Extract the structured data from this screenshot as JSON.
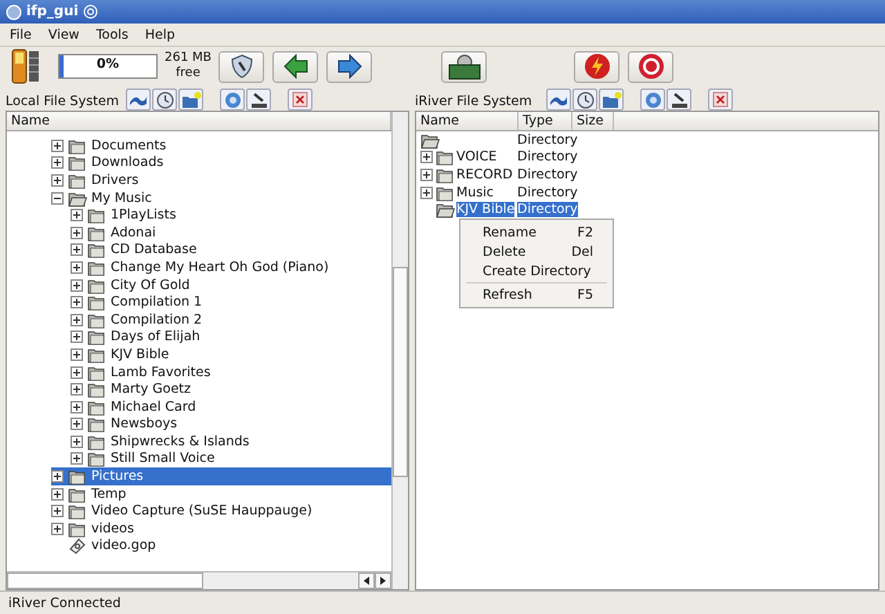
{
  "window": {
    "title": "ifp_gui"
  },
  "menu": [
    "File",
    "View",
    "Tools",
    "Help"
  ],
  "toolbar": {
    "progress": {
      "level": 0,
      "reading": "0%"
    },
    "free_space": "261 MB free"
  },
  "local": {
    "title": "Local File System",
    "column": "Name",
    "tree": [
      {
        "name": "Documents",
        "kind": "folder",
        "expanded": false,
        "selected": false
      },
      {
        "name": "Downloads",
        "kind": "folder",
        "expanded": false,
        "selected": false
      },
      {
        "name": "Drivers",
        "kind": "folder",
        "expanded": false,
        "selected": false
      },
      {
        "name": "My Music",
        "kind": "folder",
        "expanded": true,
        "selected": false,
        "children": [
          {
            "name": "1PlayLists",
            "kind": "folder",
            "expanded": false,
            "selected": false
          },
          {
            "name": "Adonai",
            "kind": "folder",
            "expanded": false,
            "selected": false
          },
          {
            "name": "CD Database",
            "kind": "folder",
            "expanded": false,
            "selected": false
          },
          {
            "name": "Change My Heart Oh God (Piano)",
            "kind": "folder",
            "expanded": false,
            "selected": false
          },
          {
            "name": "City Of Gold",
            "kind": "folder",
            "expanded": false,
            "selected": false
          },
          {
            "name": "Compilation 1",
            "kind": "folder",
            "expanded": false,
            "selected": false
          },
          {
            "name": "Compilation 2",
            "kind": "folder",
            "expanded": false,
            "selected": false
          },
          {
            "name": "Days of Elijah",
            "kind": "folder",
            "expanded": false,
            "selected": false
          },
          {
            "name": "KJV Bible",
            "kind": "folder",
            "expanded": false,
            "selected": false
          },
          {
            "name": "Lamb Favorites",
            "kind": "folder",
            "expanded": false,
            "selected": false
          },
          {
            "name": "Marty Goetz",
            "kind": "folder",
            "expanded": false,
            "selected": false
          },
          {
            "name": "Michael Card",
            "kind": "folder",
            "expanded": false,
            "selected": false
          },
          {
            "name": "Newsboys",
            "kind": "folder",
            "expanded": false,
            "selected": false
          },
          {
            "name": "Shipwrecks & Islands",
            "kind": "folder",
            "expanded": false,
            "selected": false
          },
          {
            "name": "Still Small Voice",
            "kind": "folder",
            "expanded": false,
            "selected": false
          }
        ]
      },
      {
        "name": "Pictures",
        "kind": "folder",
        "expanded": false,
        "selected": true
      },
      {
        "name": "Temp",
        "kind": "folder",
        "expanded": false,
        "selected": false
      },
      {
        "name": "Video Capture (SuSE Hauppauge)",
        "kind": "folder",
        "expanded": false,
        "selected": false
      },
      {
        "name": "videos",
        "kind": "folder",
        "expanded": false,
        "selected": false
      },
      {
        "name": "video.gop",
        "kind": "file",
        "selected": false
      }
    ]
  },
  "remote": {
    "title": "iRiver File System",
    "columns": [
      "Name",
      "Type",
      "Size"
    ],
    "rows": [
      {
        "kind": "root",
        "type": "Directory",
        "selected": false
      },
      {
        "kind": "folder",
        "name": "VOICE",
        "type": "Directory",
        "selected": false
      },
      {
        "kind": "folder",
        "name": "RECORD",
        "type": "Directory",
        "selected": false
      },
      {
        "kind": "folder",
        "name": "Music",
        "type": "Directory",
        "selected": false
      },
      {
        "kind": "open",
        "name": "KJV Bible",
        "type": "Directory",
        "selected": true
      }
    ]
  },
  "context_menu": [
    {
      "label": "Rename",
      "shortcut": "F2"
    },
    {
      "label": "Delete",
      "shortcut": "Del"
    },
    {
      "label": "Create Directory"
    },
    {
      "label": "Refresh",
      "shortcut": "F5",
      "separator_before": true
    }
  ],
  "status_bar": "iRiver Connected"
}
